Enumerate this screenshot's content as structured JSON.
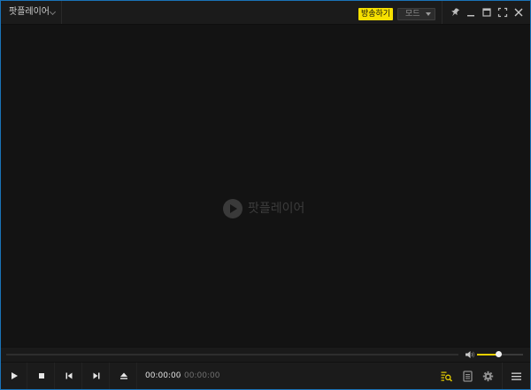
{
  "app": {
    "title": "팟플레이어",
    "broadcast_label": "방송하기",
    "mode_label": "모드"
  },
  "video": {
    "logo_text": "팟플레이어"
  },
  "playback": {
    "current_time": "00:00:00",
    "time_separator": "/",
    "total_time": "00:00:00",
    "progress": 0,
    "volume_level": 0.46
  },
  "colors": {
    "accent": "#f6e000",
    "window_border": "#1a73b8",
    "background": "#141414"
  },
  "icons": {
    "title_bar": [
      "pin-icon",
      "minimize-icon",
      "maximize-icon",
      "fullscreen-icon",
      "close-icon"
    ],
    "controls": [
      "play-icon",
      "stop-icon",
      "previous-icon",
      "next-icon",
      "eject-icon"
    ],
    "right": [
      "playlist-search-icon",
      "playlist-icon",
      "settings-gear-icon",
      "main-menu-icon"
    ]
  }
}
